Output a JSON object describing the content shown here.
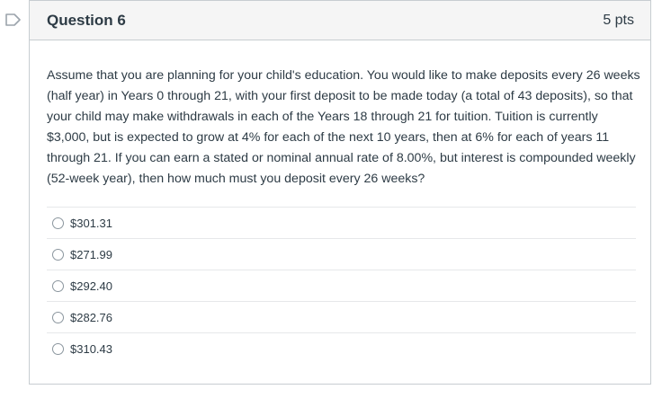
{
  "question": {
    "title": "Question 6",
    "points": "5 pts",
    "text": "Assume that you are planning for your child's education. You would like to make deposits every 26 weeks (half year) in Years 0 through 21, with your first deposit to be made today (a total of 43 deposits), so that your child may make withdrawals in each of the Years 18 through 21 for tuition. Tuition is currently $3,000, but is expected to grow at 4% for each of the next 10 years, then at 6% for each of years 11 through 21. If you can earn a stated or nominal annual rate of 8.00%, but interest is compounded weekly (52-week year), then how much must you deposit every 26 weeks?"
  },
  "answers": [
    {
      "label": "$301.31"
    },
    {
      "label": "$271.99"
    },
    {
      "label": "$292.40"
    },
    {
      "label": "$282.76"
    },
    {
      "label": "$310.43"
    }
  ],
  "icons": {
    "flag": "flag-bookmark-icon",
    "radio": "radio-unselected-icon"
  },
  "colors": {
    "text": "#2d3b45",
    "header_bg": "#f5f5f5",
    "border": "#c7cdd1",
    "flag": "#9ba3ab"
  }
}
